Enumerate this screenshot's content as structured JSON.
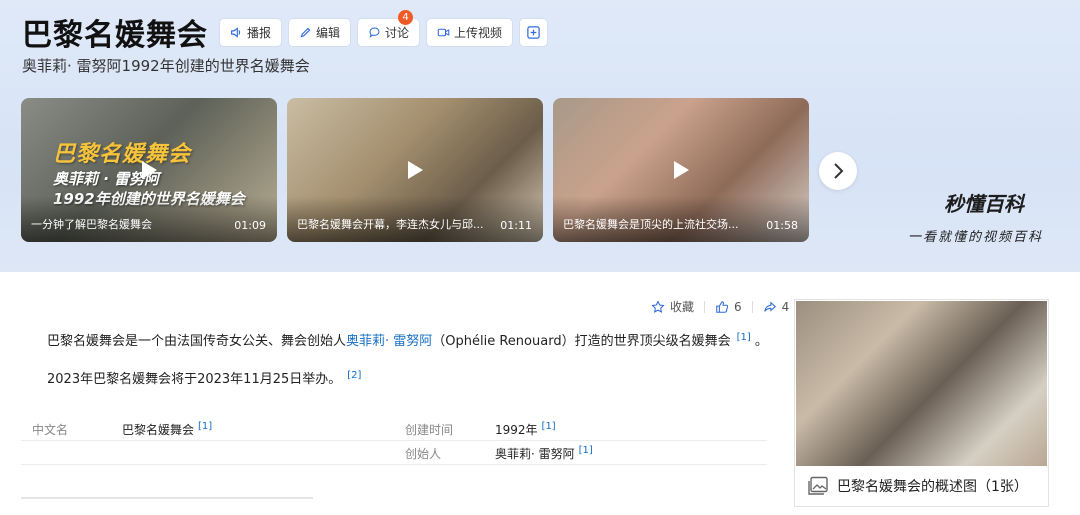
{
  "header": {
    "title": "巴黎名媛舞会",
    "subtitle": "奥菲莉· 雷努阿1992年创建的世界名媛舞会",
    "toolbar": {
      "play_label": "播报",
      "edit_label": "编辑",
      "discuss_label": "讨论",
      "discuss_badge": "4",
      "upload_label": "上传视频"
    }
  },
  "videos": [
    {
      "caption": "一分钟了解巴黎名媛舞会",
      "duration": "01:09",
      "overlay_title": "巴黎名媛舞会",
      "overlay_line1": "奥菲莉 · 雷努阿",
      "overlay_line2": "1992年创建的世界名媛舞会"
    },
    {
      "caption": "巴黎名媛舞会开幕，李连杰女儿与邱...",
      "duration": "01:11"
    },
    {
      "caption": "巴黎名媛舞会是顶尖的上流社交场...",
      "duration": "01:58"
    }
  ],
  "brand": {
    "logo": "秒懂百科",
    "tagline": "一看就懂的视频百科"
  },
  "stats": {
    "collect_label": "收藏",
    "likes": "6",
    "shares": "4"
  },
  "paragraphs": {
    "p1_before": "巴黎名媛舞会是一个由法国传奇女公关、舞会创始人",
    "p1_link": "奥菲莉· 雷努阿",
    "p1_after": "（Ophélie Renouard）打造的世界顶尖级名媛舞会",
    "p1_ref": "[1]",
    "p1_end": "。",
    "p2_text": "2023年巴黎名媛舞会将于2023年11月25日举办。",
    "p2_ref": "[2]"
  },
  "infobox": {
    "rows": [
      {
        "key": "中文名",
        "value": "巴黎名媛舞会",
        "ref": "[1]"
      },
      {
        "key": "创建时间",
        "value": "1992年",
        "ref": "[1]"
      },
      {
        "key": "创始人",
        "value": "奥菲莉· 雷努阿",
        "ref": "[1]"
      }
    ]
  },
  "side_image": {
    "caption": "巴黎名媛舞会的概述图（1张）"
  },
  "colors": {
    "accent_link": "#136ec2",
    "badge": "#f05a24",
    "header_bg": "#dfe9f8",
    "overlay_gold": "#f6c33a"
  }
}
